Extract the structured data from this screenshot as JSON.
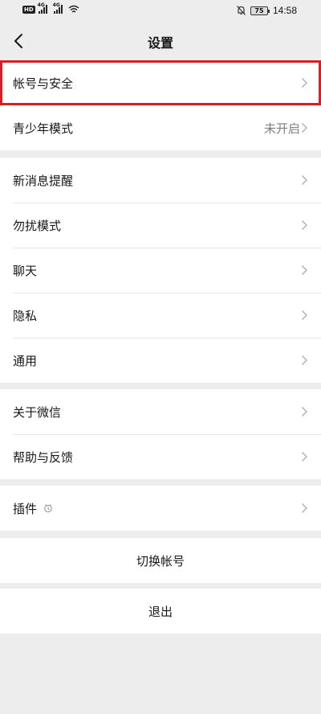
{
  "status_bar": {
    "hd_badge": "HD",
    "network_1": "4G",
    "network_2": "4G",
    "battery_level": "75",
    "time": "14:58"
  },
  "nav": {
    "title": "设置"
  },
  "groups": {
    "account": {
      "account_security": "帐号与安全",
      "teen_mode": "青少年模式",
      "teen_mode_value": "未开启"
    },
    "notifications": {
      "new_message_alerts": "新消息提醒",
      "do_not_disturb": "勿扰模式",
      "chats": "聊天",
      "privacy": "隐私",
      "general": "通用"
    },
    "about": {
      "about_wechat": "关于微信",
      "help_feedback": "帮助与反馈"
    },
    "plugins": {
      "plugins_label": "插件"
    },
    "actions": {
      "switch_account": "切换帐号",
      "log_out": "退出"
    }
  },
  "colors": {
    "background": "#ededed",
    "card": "#ffffff",
    "highlight_border": "#d81e27",
    "secondary_text": "#7f7f7f"
  }
}
